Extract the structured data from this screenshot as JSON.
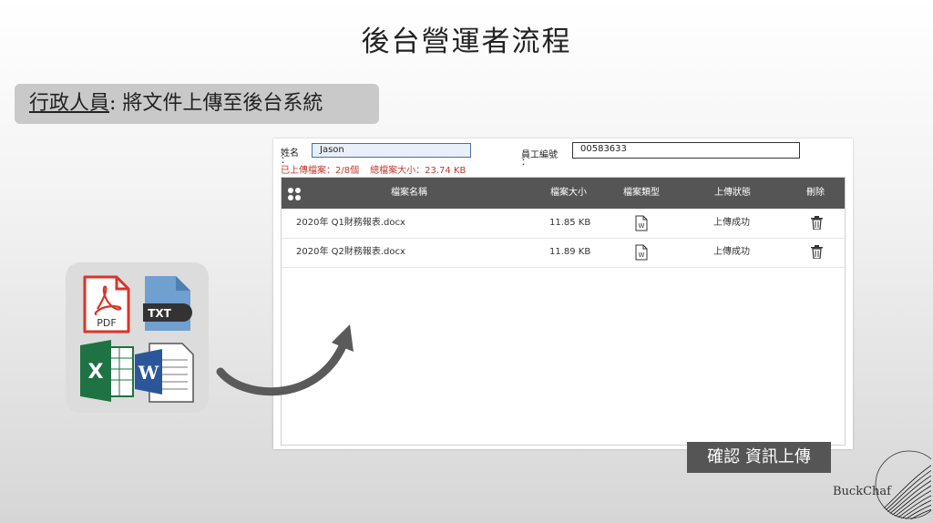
{
  "slide": {
    "title": "後台營運者流程",
    "role": "行政人員",
    "role_suffix": ": 將文件上傳至後台系統",
    "brand": "BuckChaf"
  },
  "form": {
    "name_label": "姓名",
    "name_colon": "：",
    "name_value": "Jason",
    "employee_label": "員工編號",
    "employee_colon": "：",
    "employee_value": "00583633",
    "uploaded_count": "已上傳檔案：2/8個",
    "total_size": "總檔案大小：23.74 KB"
  },
  "table": {
    "headers": {
      "name": "檔案名稱",
      "size": "檔案大小",
      "type": "檔案類型",
      "status": "上傳狀態",
      "delete": "刪除"
    },
    "rows": [
      {
        "name": "2020年 Q1財務報表.docx",
        "size": "11.85 KB",
        "type_icon": "word-doc-icon",
        "status": "上傳成功"
      },
      {
        "name": "2020年 Q2財務報表.docx",
        "size": "11.89 KB",
        "type_icon": "word-doc-icon",
        "status": "上傳成功"
      }
    ]
  },
  "confirm_button": "確認 資訊上傳",
  "file_icons": {
    "pdf": "PDF",
    "txt": "TXT",
    "excel": "X",
    "word": "W"
  },
  "colors": {
    "header_bg": "#555555",
    "stats_red": "#c0392b",
    "pdf_red": "#d9342b",
    "excel_green": "#1f7244",
    "word_blue": "#2b579a",
    "txt_blue": "#6fa0d0"
  }
}
